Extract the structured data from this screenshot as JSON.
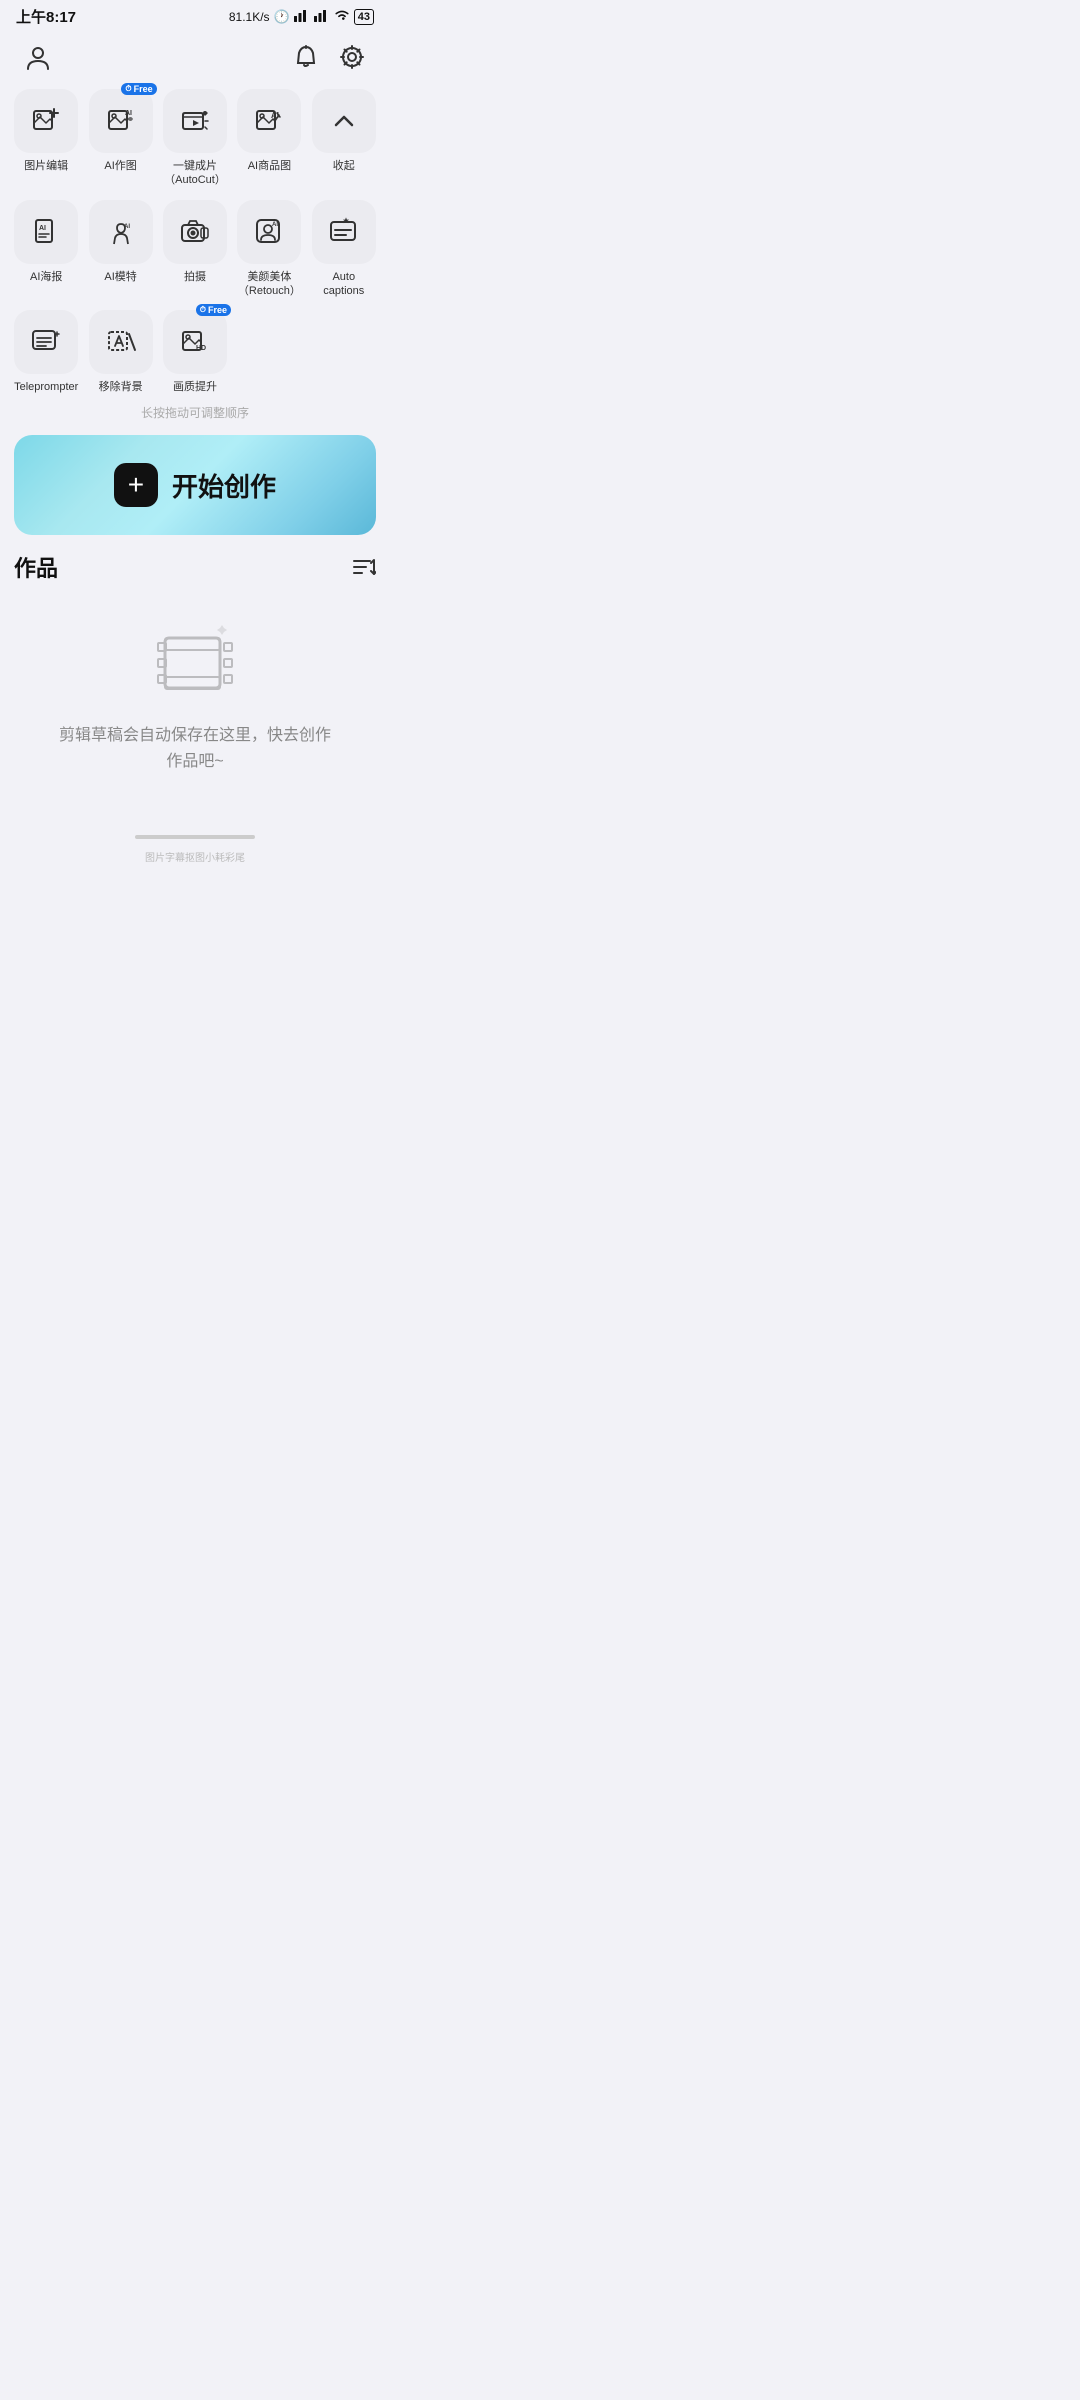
{
  "statusBar": {
    "time": "上午8:17",
    "speed": "81.1K/s",
    "battery": "43"
  },
  "nav": {
    "profile_icon": "person",
    "bell_icon": "bell",
    "settings_icon": "settings"
  },
  "toolsRow1": [
    {
      "id": "pic-edit",
      "label": "图片编辑",
      "free": false,
      "icon": "pic_edit"
    },
    {
      "id": "ai-draw",
      "label": "AI作图",
      "free": true,
      "icon": "ai_draw"
    },
    {
      "id": "autocut",
      "label": "一键成片\n（AutoCut）",
      "free": false,
      "icon": "autocut"
    },
    {
      "id": "ai-product",
      "label": "AI商品图",
      "free": false,
      "icon": "ai_product"
    },
    {
      "id": "collapse",
      "label": "收起",
      "free": false,
      "icon": "collapse"
    }
  ],
  "toolsRow2": [
    {
      "id": "ai-poster",
      "label": "AI海报",
      "free": false,
      "icon": "ai_poster"
    },
    {
      "id": "ai-model",
      "label": "AI模特",
      "free": false,
      "icon": "ai_model"
    },
    {
      "id": "camera",
      "label": "拍摄",
      "free": false,
      "icon": "camera"
    },
    {
      "id": "retouch",
      "label": "美颜美体\n（Retouch）",
      "free": false,
      "icon": "retouch"
    },
    {
      "id": "auto-captions",
      "label": "Auto captions",
      "free": false,
      "icon": "captions"
    }
  ],
  "toolsRow3": [
    {
      "id": "teleprompter",
      "label": "Teleprompter",
      "free": false,
      "icon": "teleprompter"
    },
    {
      "id": "remove-bg",
      "label": "移除背景",
      "free": false,
      "icon": "remove_bg"
    },
    {
      "id": "enhance",
      "label": "画质提升",
      "free": true,
      "icon": "enhance"
    }
  ],
  "hint": "长按拖动可调整顺序",
  "createBtn": {
    "plus": "+",
    "label": "开始创作"
  },
  "works": {
    "title": "作品",
    "sort_icon": "sort",
    "empty_text": "剪辑草稿会自动保存在这里，快去创作\n作品吧~"
  },
  "watermark": "图片字幕抠图小耗彩尾"
}
